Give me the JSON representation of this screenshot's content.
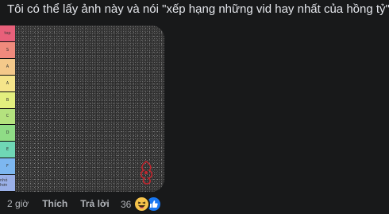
{
  "comment": {
    "text": "Tôi có thể lấy ảnh này và nói \"xếp hạng những vid hay nhất của hồng tỷ\""
  },
  "image": {
    "tiers": [
      {
        "label": "top",
        "color": "#e8607a"
      },
      {
        "label": "S",
        "color": "#f08a7c"
      },
      {
        "label": "A",
        "color": "#f4c98a"
      },
      {
        "label": "A",
        "color": "#f5e58a"
      },
      {
        "label": "B",
        "color": "#e3ef7e"
      },
      {
        "label": "C",
        "color": "#b4e27e"
      },
      {
        "label": "D",
        "color": "#8fdc86"
      },
      {
        "label": "E",
        "color": "#6fd7b5"
      },
      {
        "label": "F",
        "color": "#7db7f0"
      },
      {
        "label": "nhỏ hơn",
        "color": "#9ab0e8"
      }
    ]
  },
  "actions": {
    "time": "2 giờ",
    "like": "Thích",
    "reply": "Trả lời"
  },
  "reactions": {
    "count": "36",
    "icons": [
      "haha-icon",
      "like-icon"
    ]
  }
}
